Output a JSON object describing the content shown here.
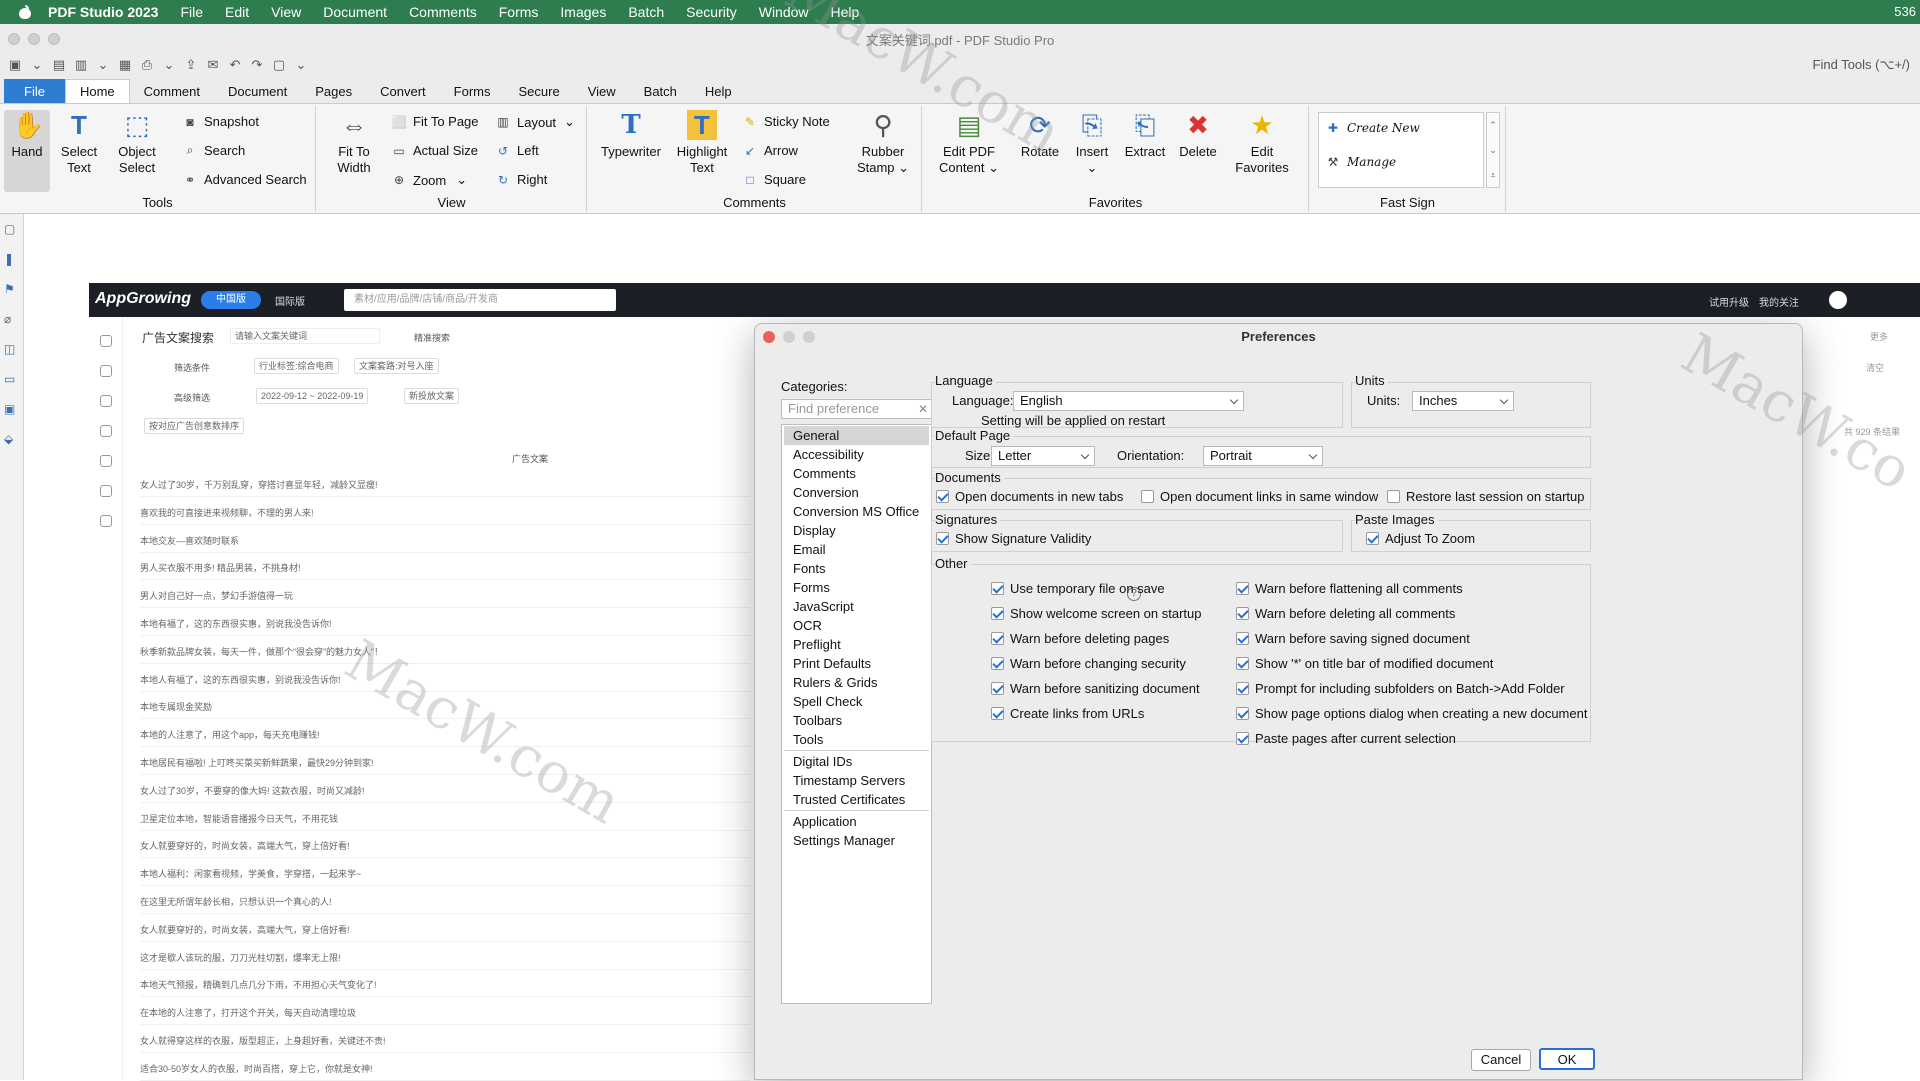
{
  "menubar": {
    "app": "PDF Studio 2023",
    "items": [
      "File",
      "Edit",
      "View",
      "Document",
      "Comments",
      "Forms",
      "Images",
      "Batch",
      "Security",
      "Window",
      "Help"
    ],
    "right": "536"
  },
  "window": {
    "title": "文案关键词.pdf - PDF Studio Pro",
    "find_tools": "Find Tools  (⌥+/)"
  },
  "tabs": [
    "File",
    "Home",
    "Comment",
    "Document",
    "Pages",
    "Convert",
    "Forms",
    "Secure",
    "View",
    "Batch",
    "Help"
  ],
  "ribbon": {
    "tools": {
      "label": "Tools",
      "hand": "Hand",
      "select_text": [
        "Select",
        "Text"
      ],
      "object_select": [
        "Object",
        "Select"
      ],
      "snapshot": "Snapshot",
      "search": "Search",
      "advanced_search": "Advanced Search"
    },
    "view": {
      "label": "View",
      "fit_width": [
        "Fit To",
        "Width"
      ],
      "fit_page": "Fit To Page",
      "actual_size": "Actual Size",
      "zoom": "Zoom",
      "layout": "Layout",
      "left": "Left",
      "right": "Right"
    },
    "comments": {
      "label": "Comments",
      "typewriter": "Typewriter",
      "highlight": [
        "Highlight",
        "Text"
      ],
      "sticky": "Sticky Note",
      "arrow": "Arrow",
      "square": "Square",
      "stamp": [
        "Rubber",
        "Stamp"
      ]
    },
    "favorites": {
      "label": "Favorites",
      "edit_pdf": [
        "Edit PDF",
        "Content"
      ],
      "rotate": "Rotate",
      "insert": "Insert",
      "extract": "Extract",
      "delete": "Delete",
      "edit_fav": [
        "Edit",
        "Favorites"
      ]
    },
    "fastsign": {
      "label": "Fast Sign",
      "create": "Create New",
      "manage": "Manage"
    }
  },
  "appgrowing": {
    "logo": "AppGrowing",
    "cn": "中国版",
    "intl": "国际版",
    "search_ph": "素材/应用/品牌/店铺/商品/开发商",
    "top_right": [
      "试用升级",
      "我的关注"
    ],
    "page_title": "广告文案搜索",
    "kw_ph": "请输入文案关键词",
    "precise": "精准搜索",
    "filter": "筛选条件",
    "chip1": "行业标签:综合电商",
    "chip2": "文案套路:对号入座",
    "adv": "高级筛选",
    "date": "2022-09-12 ~ 2022-09-19",
    "new_ad": "新投放文案",
    "sort": "按对应广告创意数排序",
    "col": "广告文案",
    "more": "更多",
    "clear": "清空",
    "count": "共 929 条结果",
    "rows": [
      "女人过了30岁，千万别乱穿，穿搭讨喜显年轻，减龄又显瘦!",
      "喜欢我的可直接进来视频聊，不理的男人来!",
      "本地交友—喜欢随时联系",
      "男人买衣服不用多! 精品男装，不挑身材!",
      "男人对自己好一点，梦幻手游值得一玩",
      "本地有福了，这的东西很实惠，别说我没告诉你!",
      "秋季新款品牌女装，每天一件，做那个“很会穿”的魅力女人”！",
      "本地人有福了，这的东西很实惠，别说我没告诉你!",
      "本地专属现金奖励",
      "本地的人注意了，用这个app，每天充电赚钱!",
      "本地居民有福啦! 上叮咚买菜买新鲜蔬果，最快29分钟到家!",
      "女人过了30岁，不要穿的像大妈! 这款衣服，时尚又减龄!",
      "卫星定位本地，智能语音播报今日天气，不用花钱",
      "女人就要穿好的，时尚女装，高端大气，穿上倍好看!",
      "本地人福利：闲家看视频，学美食，学穿搭，一起来学~",
      "在这里无所谓年龄长相，只想认识一个真心的人!",
      "女人就要穿好的，时尚女装，高端大气，穿上倍好看!",
      "这才是歇人该玩的服，刀刀光柱切割，爆率无上限!",
      "本地天气预报，精确到几点几分下雨，不用担心天气变化了!",
      "在本地的人注意了，打开这个开关，每天自动清理垃圾",
      "女人就得穿这样的衣服，版型超正，上身超好看，关键还不贵!",
      "适合30-50岁女人的衣服，时尚百搭，穿上它，你就是女神!"
    ]
  },
  "dialog": {
    "title": "Preferences",
    "categories_label": "Categories:",
    "find_ph": "Find preference",
    "categories": [
      "General",
      "Accessibility",
      "Comments",
      "Conversion",
      "Conversion MS Office",
      "Display",
      "Email",
      "Fonts",
      "Forms",
      "JavaScript",
      "OCR",
      "Preflight",
      "Print Defaults",
      "Rulers & Grids",
      "Spell Check",
      "Toolbars",
      "Tools"
    ],
    "categories2": [
      "Digital IDs",
      "Timestamp Servers",
      "Trusted Certificates"
    ],
    "categories3": [
      "Application",
      "Settings Manager"
    ],
    "language": {
      "title": "Language",
      "label": "Language:",
      "value": "English",
      "note": "Setting will be applied on restart"
    },
    "units": {
      "title": "Units",
      "label": "Units:",
      "value": "Inches"
    },
    "default_page": {
      "title": "Default Page",
      "size_label": "Size:",
      "size": "Letter",
      "orient_label": "Orientation:",
      "orient": "Portrait"
    },
    "documents": {
      "title": "Documents",
      "c1": "Open documents in new tabs",
      "c2": "Open document links in same window",
      "c3": "Restore last session on startup"
    },
    "signatures": {
      "title": "Signatures",
      "c1": "Show Signature Validity"
    },
    "paste_images": {
      "title": "Paste Images",
      "c1": "Adjust To Zoom"
    },
    "other": {
      "title": "Other",
      "left": [
        "Use temporary file on save",
        "Show welcome screen on startup",
        "Warn before deleting pages",
        "Warn before changing security",
        "Warn before sanitizing document",
        "Create links from URLs"
      ],
      "right": [
        "Warn before flattening all comments",
        "Warn before deleting all comments",
        "Warn before saving signed document",
        "Show '*' on title bar of modified document",
        "Prompt for including subfolders on Batch->Add Folder",
        "Show page options dialog when creating a new document",
        "Paste pages after current selection"
      ]
    },
    "cancel": "Cancel",
    "ok": "OK"
  },
  "watermarks": [
    "MacW.com",
    "MacW.co",
    "MacW.com"
  ]
}
